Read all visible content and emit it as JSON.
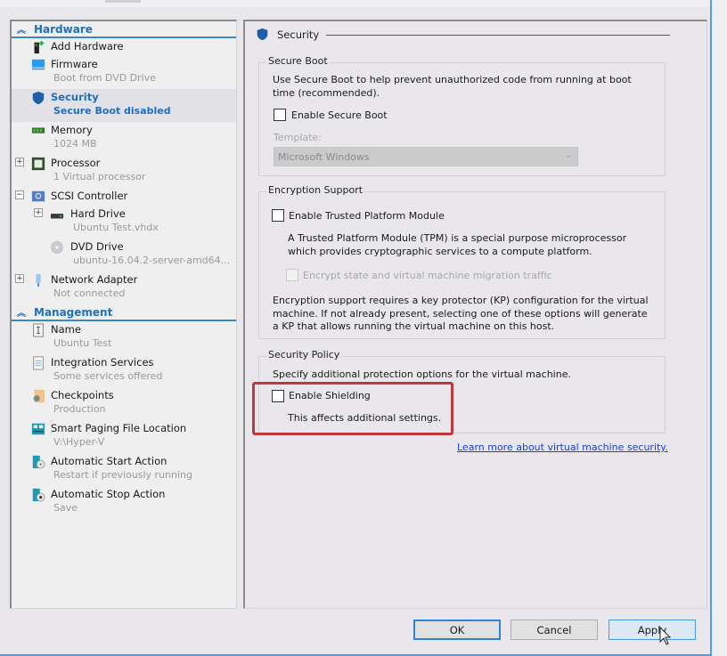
{
  "sidebar": {
    "sections": [
      {
        "label": "Hardware",
        "items": [
          {
            "label": "Add Hardware",
            "sub": "",
            "icon": "add-hardware-icon"
          },
          {
            "label": "Firmware",
            "sub": "Boot from DVD Drive",
            "icon": "monitor-icon"
          },
          {
            "label": "Security",
            "sub": "Secure Boot disabled",
            "icon": "shield-icon",
            "selected": true
          },
          {
            "label": "Memory",
            "sub": "1024 MB",
            "icon": "memory-icon"
          },
          {
            "label": "Processor",
            "sub": "1 Virtual processor",
            "icon": "processor-icon",
            "expandable": "+"
          },
          {
            "label": "SCSI Controller",
            "sub": "",
            "icon": "scsi-controller-icon",
            "expandable": "−"
          },
          {
            "label": "Hard Drive",
            "sub": "Ubuntu Test.vhdx",
            "icon": "hard-drive-icon",
            "expandable": "+"
          },
          {
            "label": "DVD Drive",
            "sub": "ubuntu-16.04.2-server-amd64...",
            "icon": "dvd-icon"
          },
          {
            "label": "Network Adapter",
            "sub": "Not connected",
            "icon": "network-adapter-icon",
            "expandable": "+"
          }
        ]
      },
      {
        "label": "Management",
        "items": [
          {
            "label": "Name",
            "sub": "Ubuntu Test",
            "icon": "name-icon"
          },
          {
            "label": "Integration Services",
            "sub": "Some services offered",
            "icon": "integration-services-icon"
          },
          {
            "label": "Checkpoints",
            "sub": "Production",
            "icon": "checkpoints-icon"
          },
          {
            "label": "Smart Paging File Location",
            "sub": "V:\\Hyper-V",
            "icon": "smart-paging-icon"
          },
          {
            "label": "Automatic Start Action",
            "sub": "Restart if previously running",
            "icon": "auto-start-icon"
          },
          {
            "label": "Automatic Stop Action",
            "sub": "Save",
            "icon": "auto-stop-icon"
          }
        ]
      }
    ]
  },
  "pane": {
    "title": "Security",
    "secure_boot": {
      "title": "Secure Boot",
      "description": "Use Secure Boot to help prevent unauthorized code from running at boot time (recommended).",
      "checkbox_label": "Enable Secure Boot",
      "checked": false,
      "template_label": "Template:",
      "template_value": "Microsoft Windows"
    },
    "encryption": {
      "title": "Encryption Support",
      "tpm_label": "Enable Trusted Platform Module",
      "tpm_checked": false,
      "tpm_description": "A Trusted Platform Module (TPM) is a special purpose microprocessor which provides cryptographic services to a compute platform.",
      "encrypt_label": "Encrypt state and virtual machine migration traffic",
      "encrypt_checked": false,
      "note": "Encryption support requires a key protector (KP) configuration for the virtual machine. If not already present, selecting one of these options will generate a KP that allows running the virtual machine on this host."
    },
    "policy": {
      "title": "Security Policy",
      "description": "Specify additional protection options for the virtual machine.",
      "shielding_label": "Enable Shielding",
      "shielding_checked": false,
      "shielding_note": "This affects additional settings."
    },
    "learn_more": "Learn more about virtual machine security."
  },
  "buttons": {
    "ok": "OK",
    "cancel": "Cancel",
    "apply": "Apply"
  },
  "colors": {
    "accent": "#1f6fc0",
    "highlight_box": "#c0383e",
    "link": "#1a3fd8"
  }
}
